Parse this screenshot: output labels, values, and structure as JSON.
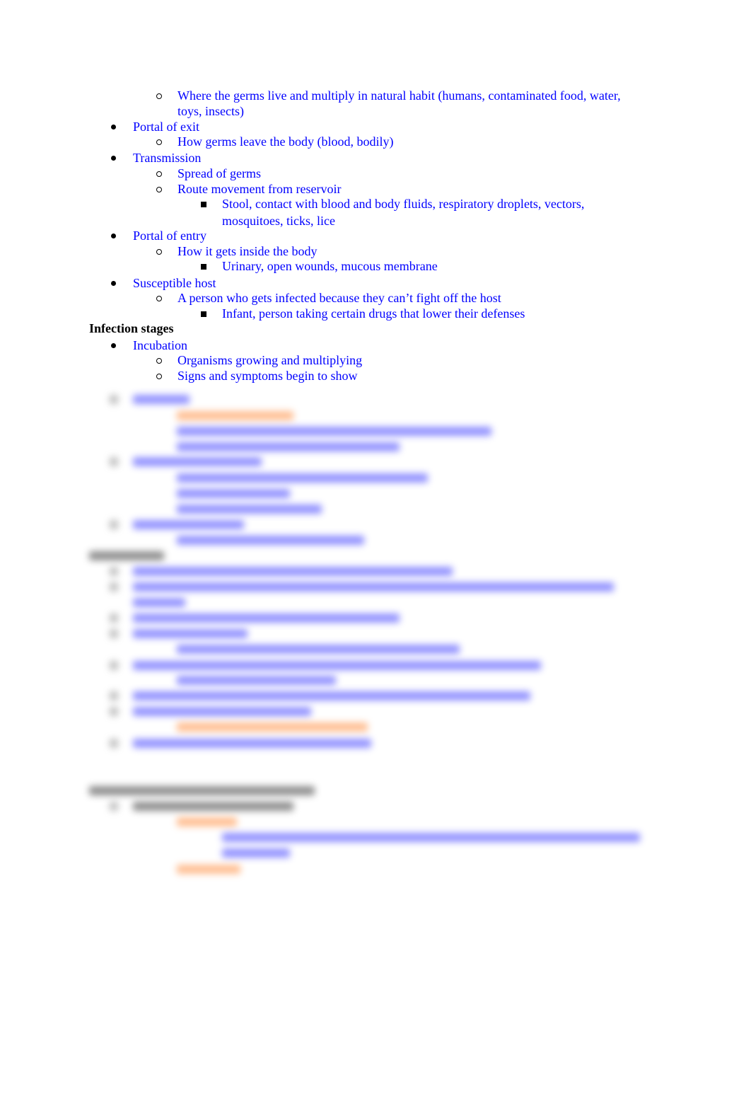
{
  "document": {
    "colors": {
      "text": "#0000ff",
      "heading": "#000000",
      "highlight": "#ff8a3a"
    },
    "chain_items": [
      {
        "level": 2,
        "text": "Where the germs live and multiply in natural habit (humans, contaminated food, water,"
      },
      {
        "level": 2,
        "text": "toys, insects)",
        "continuation": true
      },
      {
        "level": 1,
        "text": "Portal of exit"
      },
      {
        "level": 2,
        "text": "How germs leave the body (blood, bodily)"
      },
      {
        "level": 1,
        "text": "Transmission"
      },
      {
        "level": 2,
        "text": "Spread of germs"
      },
      {
        "level": 2,
        "text": "Route movement from reservoir"
      },
      {
        "level": 3,
        "text": "Stool, contact with blood and body fluids, respiratory droplets, vectors,"
      },
      {
        "level": 3,
        "text": "mosquitoes, ticks, lice",
        "continuation": true
      },
      {
        "level": 1,
        "text": "Portal of entry"
      },
      {
        "level": 2,
        "text": "How it gets inside the body"
      },
      {
        "level": 3,
        "text": "Urinary, open wounds, mucous membrane"
      },
      {
        "level": 1,
        "text": "Susceptible host"
      },
      {
        "level": 2,
        "text": "A person who gets infected because they can’t fight off the host"
      },
      {
        "level": 3,
        "text": "Infant, person taking certain drugs that lower their defenses"
      }
    ],
    "stages_heading": "Infection stages",
    "stages_items": [
      {
        "level": 1,
        "text": "Incubation"
      },
      {
        "level": 2,
        "text": "Organisms growing and multiplying"
      },
      {
        "level": 2,
        "text": "Signs and symptoms begin to show"
      }
    ],
    "blurred_notice": "remaining content obscured"
  }
}
